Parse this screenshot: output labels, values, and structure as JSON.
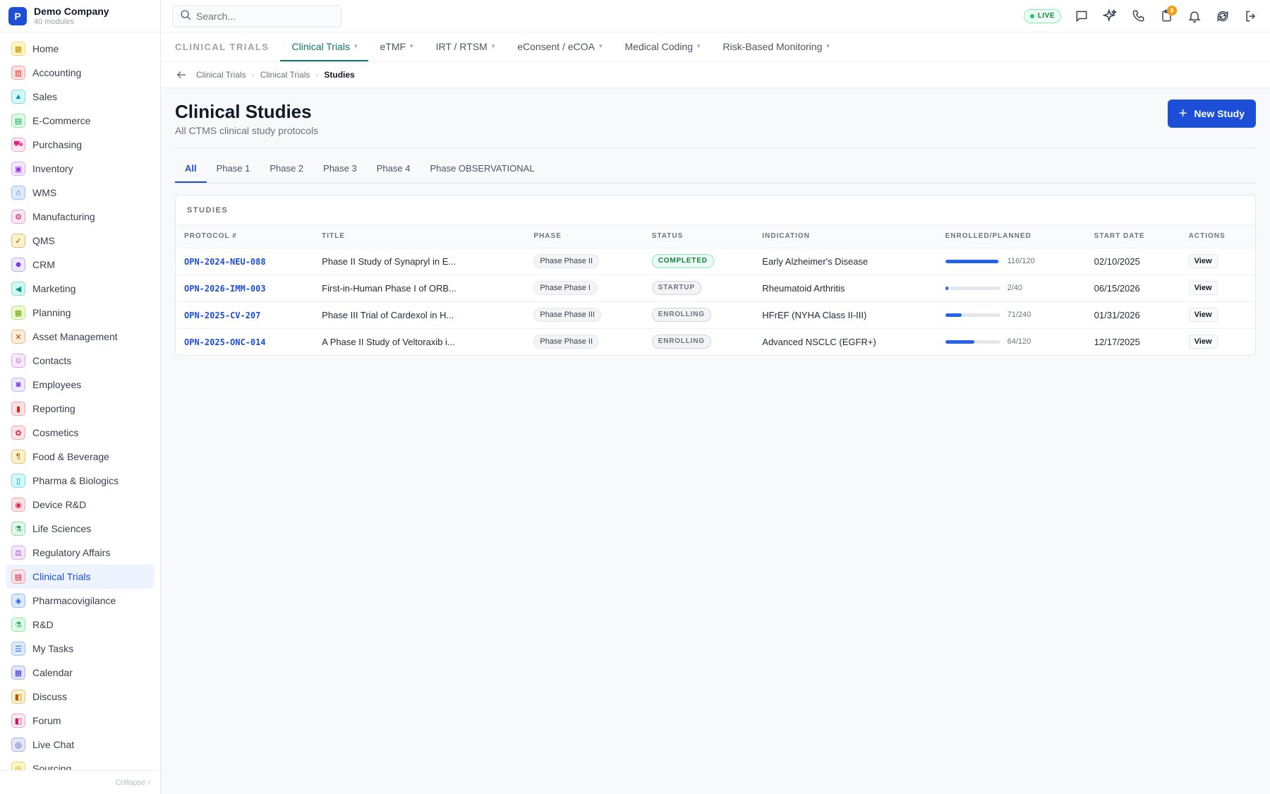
{
  "brand": {
    "logo_letter": "P",
    "name": "Demo Company",
    "sub": "40 modules"
  },
  "sidebar": {
    "items": [
      {
        "label": "Home",
        "icon": "grid-icon",
        "glyph": "▦",
        "color": "#ca8a04",
        "bg": "#fef9c3"
      },
      {
        "label": "Accounting",
        "icon": "bank-icon",
        "glyph": "▥",
        "color": "#dc2626",
        "bg": "#fee2e2"
      },
      {
        "label": "Sales",
        "icon": "flask-icon",
        "glyph": "▲",
        "color": "#0891b2",
        "bg": "#cffafe"
      },
      {
        "label": "E-Commerce",
        "icon": "store-icon",
        "glyph": "▤",
        "color": "#16a34a",
        "bg": "#dcfce7"
      },
      {
        "label": "Purchasing",
        "icon": "cart-icon",
        "glyph": "⛟",
        "color": "#db2777",
        "bg": "#fce7f3"
      },
      {
        "label": "Inventory",
        "icon": "box-icon",
        "glyph": "▣",
        "color": "#9333ea",
        "bg": "#f3e8ff"
      },
      {
        "label": "WMS",
        "icon": "warehouse-icon",
        "glyph": "⌂",
        "color": "#2563eb",
        "bg": "#dbeafe"
      },
      {
        "label": "Manufacturing",
        "icon": "factory-icon",
        "glyph": "⚙",
        "color": "#be185d",
        "bg": "#fce7f3"
      },
      {
        "label": "QMS",
        "icon": "check-badge-icon",
        "glyph": "✓",
        "color": "#92400e",
        "bg": "#fef3c7"
      },
      {
        "label": "CRM",
        "icon": "users-icon",
        "glyph": "☻",
        "color": "#6d28d9",
        "bg": "#ede9fe"
      },
      {
        "label": "Marketing",
        "icon": "megaphone-icon",
        "glyph": "◀",
        "color": "#0d9488",
        "bg": "#ccfbf1"
      },
      {
        "label": "Planning",
        "icon": "calendar-icon",
        "glyph": "▦",
        "color": "#65a30d",
        "bg": "#ecfccb"
      },
      {
        "label": "Asset Management",
        "icon": "tools-icon",
        "glyph": "✕",
        "color": "#c2410c",
        "bg": "#ffedd5"
      },
      {
        "label": "Contacts",
        "icon": "contact-icon",
        "glyph": "☺",
        "color": "#a21caf",
        "bg": "#fae8ff"
      },
      {
        "label": "Employees",
        "icon": "id-card-icon",
        "glyph": "◙",
        "color": "#7c3aed",
        "bg": "#ede9fe"
      },
      {
        "label": "Reporting",
        "icon": "bar-chart-icon",
        "glyph": "▮",
        "color": "#dc2626",
        "bg": "#fee2e2"
      },
      {
        "label": "Cosmetics",
        "icon": "flower-icon",
        "glyph": "✿",
        "color": "#e11d48",
        "bg": "#ffe4e6"
      },
      {
        "label": "Food & Beverage",
        "icon": "utensils-icon",
        "glyph": "¶",
        "color": "#b45309",
        "bg": "#fef3c7"
      },
      {
        "label": "Pharma & Biologics",
        "icon": "pill-bottle-icon",
        "glyph": "▯",
        "color": "#0891b2",
        "bg": "#cffafe"
      },
      {
        "label": "Device R&D",
        "icon": "chip-icon",
        "glyph": "◉",
        "color": "#e11d48",
        "bg": "#ffe4e6"
      },
      {
        "label": "Life Sciences",
        "icon": "microscope-icon",
        "glyph": "⚗",
        "color": "#15803d",
        "bg": "#dcfce7"
      },
      {
        "label": "Regulatory Affairs",
        "icon": "gavel-icon",
        "glyph": "⚖",
        "color": "#9333ea",
        "bg": "#f3e8ff"
      },
      {
        "label": "Clinical Trials",
        "icon": "clipboard-icon",
        "glyph": "▤",
        "color": "#be123c",
        "bg": "#ffe4e6"
      },
      {
        "label": "Pharmacovigilance",
        "icon": "shield-icon",
        "glyph": "◈",
        "color": "#1d4ed8",
        "bg": "#dbeafe"
      },
      {
        "label": "R&D",
        "icon": "beaker-icon",
        "glyph": "⚗",
        "color": "#16a34a",
        "bg": "#dcfce7"
      },
      {
        "label": "My Tasks",
        "icon": "checklist-icon",
        "glyph": "☰",
        "color": "#2563eb",
        "bg": "#dbeafe"
      },
      {
        "label": "Calendar",
        "icon": "calendar-icon",
        "glyph": "▦",
        "color": "#4338ca",
        "bg": "#e0e7ff"
      },
      {
        "label": "Discuss",
        "icon": "chat-icon",
        "glyph": "◧",
        "color": "#b45309",
        "bg": "#fef3c7"
      },
      {
        "label": "Forum",
        "icon": "forum-icon",
        "glyph": "◧",
        "color": "#be185d",
        "bg": "#fce7f3"
      },
      {
        "label": "Live Chat",
        "icon": "headset-icon",
        "glyph": "◎",
        "color": "#4338ca",
        "bg": "#e0e7ff"
      },
      {
        "label": "Sourcing",
        "icon": "target-icon",
        "glyph": "◎",
        "color": "#ca8a04",
        "bg": "#fef9c3"
      }
    ],
    "active_index": 22,
    "collapse_label": "Collapse ‹"
  },
  "topbar": {
    "search_placeholder": "Search...",
    "live_label": "LIVE",
    "notification_count": "9"
  },
  "modbar": {
    "title": "CLINICAL TRIALS",
    "tabs": [
      {
        "label": "Clinical Trials",
        "active": true
      },
      {
        "label": "eTMF",
        "active": false
      },
      {
        "label": "IRT / RTSM",
        "active": false
      },
      {
        "label": "eConsent / eCOA",
        "active": false
      },
      {
        "label": "Medical Coding",
        "active": false
      },
      {
        "label": "Risk-Based Monitoring",
        "active": false
      }
    ]
  },
  "breadcrumb": {
    "items": [
      "Clinical Trials",
      "Clinical Trials"
    ],
    "current": "Studies"
  },
  "page": {
    "title": "Clinical Studies",
    "subtitle": "All CTMS clinical study protocols",
    "new_button": "New Study"
  },
  "phase_tabs": [
    "All",
    "Phase 1",
    "Phase 2",
    "Phase 3",
    "Phase 4",
    "Phase OBSERVATIONAL"
  ],
  "studies": {
    "card_title": "STUDIES",
    "columns": [
      "PROTOCOL #",
      "TITLE",
      "PHASE",
      "STATUS",
      "INDICATION",
      "ENROLLED/PLANNED",
      "START DATE",
      "ACTIONS"
    ],
    "rows": [
      {
        "protocol": "OPN-2024-NEU-088",
        "title": "Phase II Study of Synapryl in E...",
        "phase": "Phase Phase II",
        "status": "COMPLETED",
        "status_key": "completed",
        "indication": "Early Alzheimer's Disease",
        "enrolled": 116,
        "planned": 120,
        "enrolled_text": "116/120",
        "start": "02/10/2025",
        "action": "View"
      },
      {
        "protocol": "OPN-2026-IMM-003",
        "title": "First-in-Human Phase I of ORB...",
        "phase": "Phase Phase I",
        "status": "STARTUP",
        "status_key": "startup",
        "indication": "Rheumatoid Arthritis",
        "enrolled": 2,
        "planned": 40,
        "enrolled_text": "2/40",
        "start": "06/15/2026",
        "action": "View"
      },
      {
        "protocol": "OPN-2025-CV-207",
        "title": "Phase III Trial of Cardexol in H...",
        "phase": "Phase Phase III",
        "status": "ENROLLING",
        "status_key": "enrolling",
        "indication": "HFrEF (NYHA Class II-III)",
        "enrolled": 71,
        "planned": 240,
        "enrolled_text": "71/240",
        "start": "01/31/2026",
        "action": "View"
      },
      {
        "protocol": "OPN-2025-ONC-014",
        "title": "A Phase II Study of Veltoraxib i...",
        "phase": "Phase Phase II",
        "status": "ENROLLING",
        "status_key": "enrolling",
        "indication": "Advanced NSCLC (EGFR+)",
        "enrolled": 64,
        "planned": 120,
        "enrolled_text": "64/120",
        "start": "12/17/2025",
        "action": "View"
      }
    ]
  }
}
